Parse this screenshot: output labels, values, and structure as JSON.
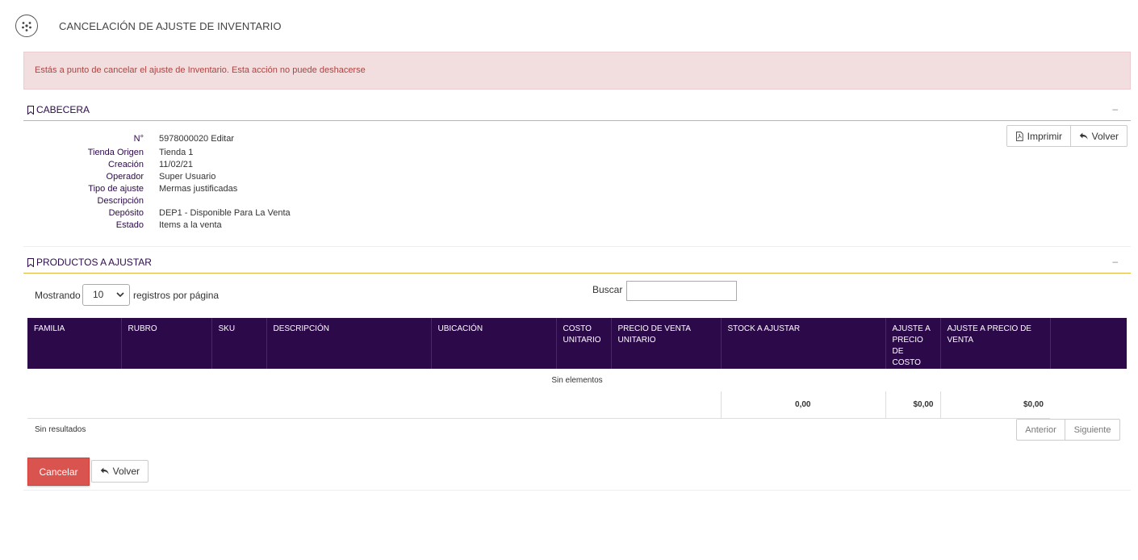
{
  "page": {
    "title": "CANCELACIÓN DE AJUSTE DE INVENTARIO"
  },
  "alert": {
    "message": "Estás a punto de cancelar el ajuste de Inventario. Esta acción no puede deshacerse",
    "color": "#a94442"
  },
  "cabecera": {
    "title": "CABECERA",
    "collapse": "–",
    "print_label": "Imprimir",
    "back_label": "Volver",
    "fields": [
      {
        "label": "N°",
        "value": "5978000020 Editar"
      },
      {
        "label": "Tienda Origen",
        "value": "Tienda 1"
      },
      {
        "label": "Creación",
        "value": "11/02/21"
      },
      {
        "label": "Operador",
        "value": "Super Usuario"
      },
      {
        "label": "Tipo de ajuste",
        "value": "Mermas justificadas"
      },
      {
        "label": "Descripción",
        "value": ""
      },
      {
        "label": "Depósito",
        "value": "DEP1 - Disponible Para La Venta"
      },
      {
        "label": "Estado",
        "value": "Items a la venta"
      }
    ]
  },
  "productos": {
    "title": "PRODUCTOS A AJUSTAR",
    "collapse": "–",
    "length_label": "Mostrando",
    "length_value": "10",
    "length_suffix": "registros por página",
    "search_label": "Buscar",
    "search_value": "",
    "columns": [
      "FAMILIA",
      "RUBRO",
      "SKU",
      "DESCRIPCIÓN",
      "UBICACIÓN",
      "COSTO UNITARIO",
      "PRECIO DE VENTA UNITARIO",
      "STOCK A AJUSTAR",
      "AJUSTE A PRECIO DE COSTO",
      "AJUSTE A PRECIO DE VENTA",
      ""
    ],
    "empty_text": "Sin elementos",
    "totals": {
      "stock": "0,00",
      "costo": "$0,00",
      "venta": "$0,00"
    },
    "info": "Sin resultados",
    "prev_label": "Anterior",
    "next_label": "Siguiente"
  },
  "footer": {
    "cancel_label": "Cancelar",
    "back_label": "Volver"
  },
  "colors": {
    "header_bg": "#2c0a4a",
    "accent_line": "#e5b43c",
    "danger": "#d9534f",
    "alert_bg": "#f2dede"
  }
}
